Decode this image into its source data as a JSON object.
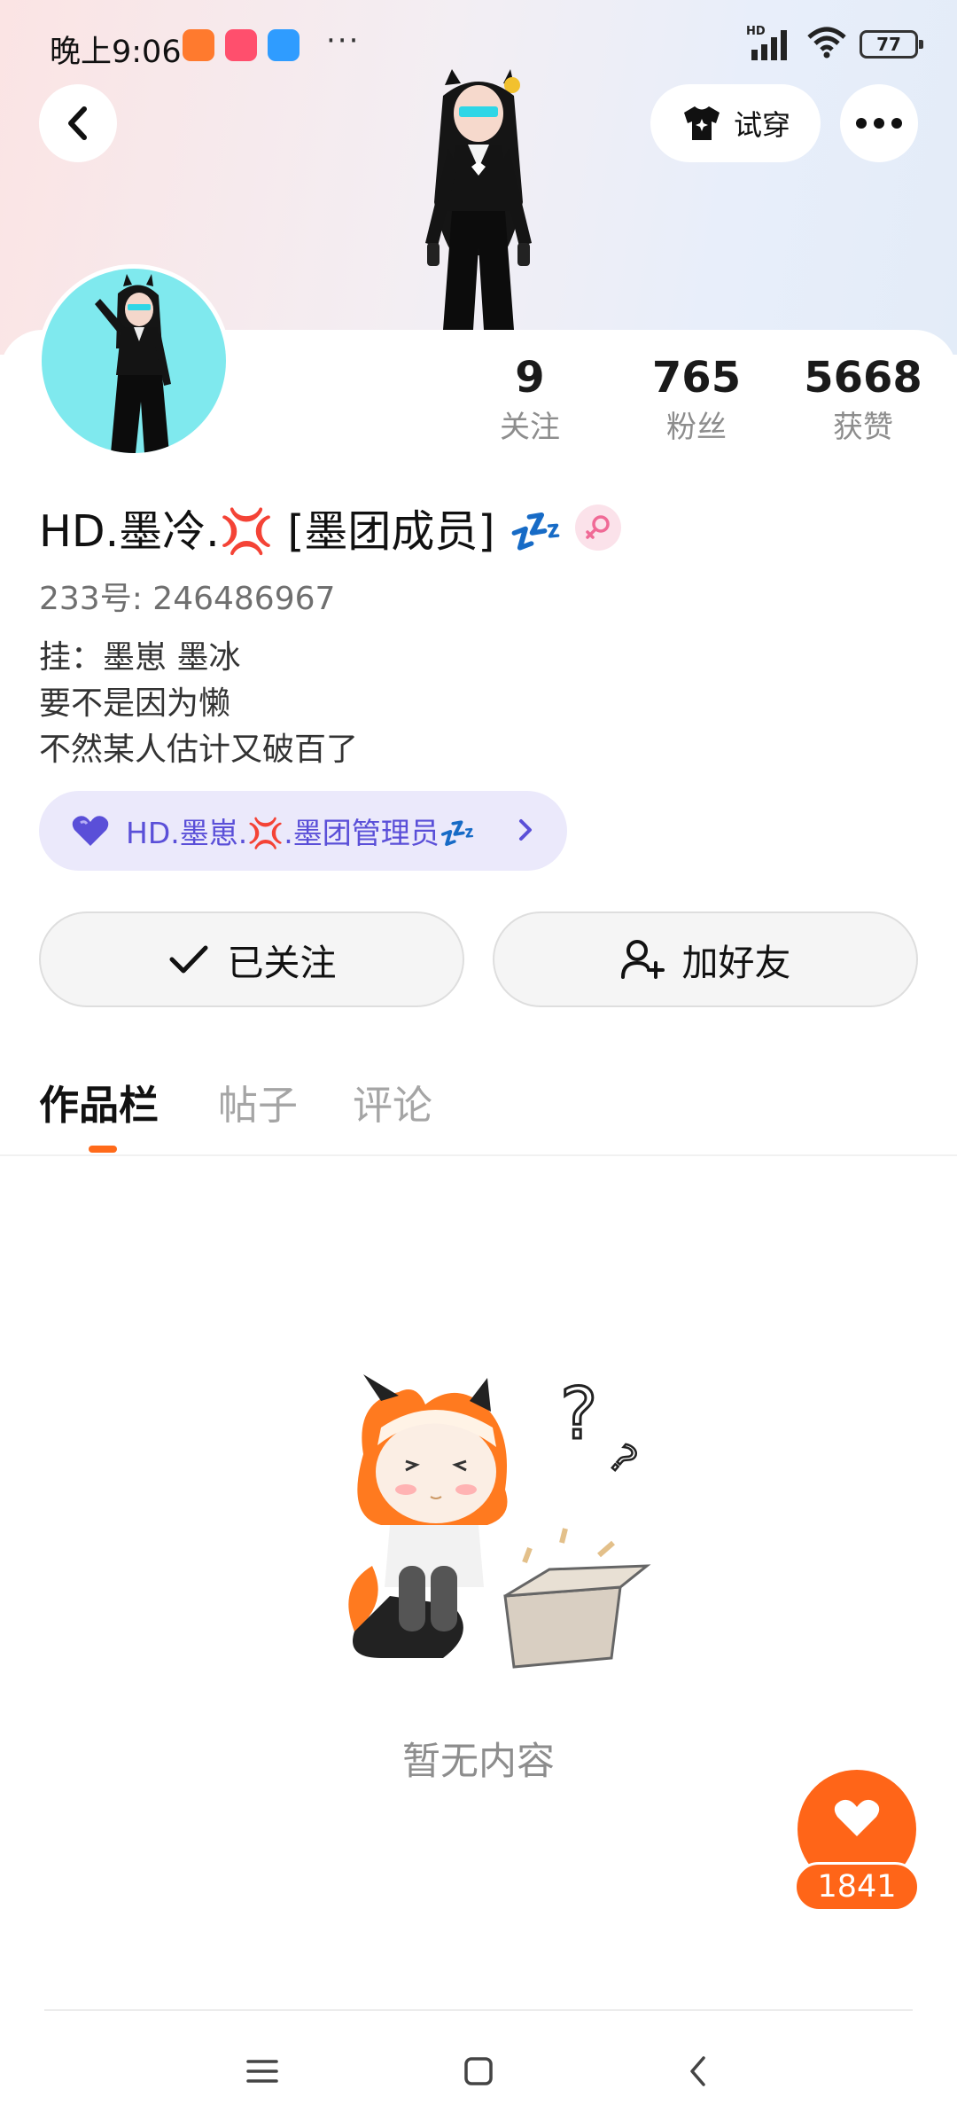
{
  "status_bar": {
    "time": "晚上9:06",
    "dots": "···",
    "network_label": "HD",
    "battery": "77"
  },
  "header": {
    "tryon_label": "试穿"
  },
  "stats": [
    {
      "value": "9",
      "label": "关注"
    },
    {
      "value": "765",
      "label": "粉丝"
    },
    {
      "value": "5668",
      "label": "获赞"
    }
  ],
  "profile": {
    "name": "HD.墨冷.💢 [墨团成员] 💤",
    "id_line": "233号: 246486967",
    "bio": [
      "挂：墨崽 墨冰",
      "要不是因为懒",
      "不然某人估计又破百了"
    ]
  },
  "tag_pill": {
    "label": "HD.墨崽.💢.墨团管理员💤"
  },
  "actions": {
    "followed_label": "已关注",
    "add_friend_label": "加好友"
  },
  "tabs": [
    {
      "label": "作品栏",
      "active": true
    },
    {
      "label": "帖子",
      "active": false
    },
    {
      "label": "评论",
      "active": false
    }
  ],
  "empty_state": {
    "text": "暂无内容"
  },
  "like_fab": {
    "count": "1841"
  },
  "colors": {
    "accent": "#ff6518",
    "tag_text": "#5a4fd8",
    "tag_bg": "#ebe9fb",
    "avatar_bg": "#7fe9ee"
  }
}
